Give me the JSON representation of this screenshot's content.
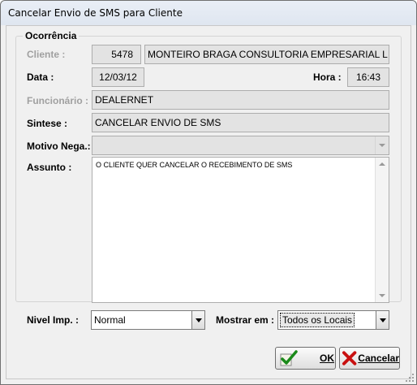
{
  "window": {
    "title": "Cancelar Envio de SMS para Cliente"
  },
  "group": {
    "title": "Ocorrência"
  },
  "cliente": {
    "label": "Cliente :",
    "code": "5478",
    "name": "MONTEIRO BRAGA CONSULTORIA EMPRESARIAL L"
  },
  "data": {
    "label": "Data :",
    "value": "12/03/12"
  },
  "hora": {
    "label": "Hora :",
    "value": "16:43"
  },
  "funcionario": {
    "label": "Funcionário :",
    "value": "DEALERNET"
  },
  "sintese": {
    "label": "Sintese :",
    "value": "CANCELAR ENVIO DE SMS"
  },
  "motivo": {
    "label": "Motivo Nega.:",
    "value": ""
  },
  "assunto": {
    "label": "Assunto :",
    "value": "O CLIENTE QUER CANCELAR O RECEBIMENTO DE SMS"
  },
  "nivel": {
    "label": "Nivel Imp. :",
    "selected": "Normal"
  },
  "mostrar": {
    "label": "Mostrar em :",
    "selected": "Todos os Locais"
  },
  "buttons": {
    "ok_label": "OK",
    "cancel_label": "Cancelar"
  },
  "colors": {
    "ok_check": "#1a8a1a",
    "cancel_x": "#c81010"
  },
  "icons": {
    "ok": "green-checkmark-icon",
    "cancel": "red-x-icon"
  }
}
